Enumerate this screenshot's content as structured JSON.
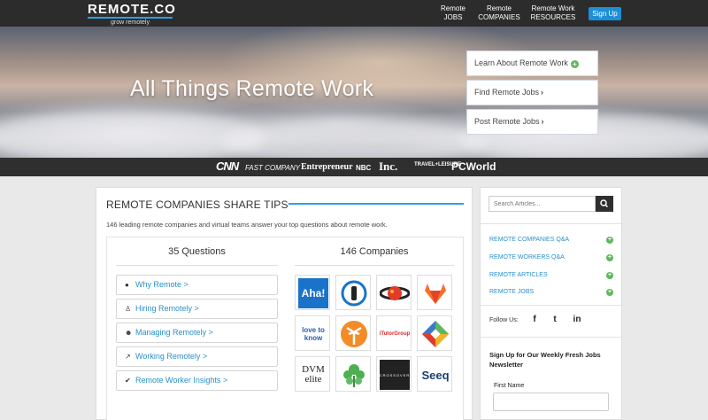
{
  "brand": {
    "name": "REMOTE.CO",
    "tagline": "grow remotely"
  },
  "nav": {
    "jobs": {
      "line1": "Remote",
      "line2": "JOBS"
    },
    "companies": {
      "line1": "Remote",
      "line2": "COMPANIES"
    },
    "resources": {
      "line1": "Remote Work",
      "line2": "RESOURCES"
    },
    "signup": "Sign Up"
  },
  "hero": {
    "title": "All Things Remote Work",
    "buttons": [
      {
        "label": "Learn About Remote Work",
        "icon": "plus-circle-icon"
      },
      {
        "label": "Find Remote Jobs",
        "icon": "chevron-right-icon"
      },
      {
        "label": "Post Remote Jobs",
        "icon": "chevron-right-icon"
      }
    ]
  },
  "press": [
    "CNN",
    "FAST COMPANY",
    "Entrepreneur",
    "NBC",
    "Inc.",
    "TRAVEL+LEISURE",
    "PCWorld"
  ],
  "main": {
    "title": "REMOTE COMPANIES SHARE TIPS",
    "description": "146 leading remote companies and virtual teams answer your top questions about remote work.",
    "questions_heading": "35 Questions",
    "companies_heading": "146 Companies",
    "questions": [
      {
        "label": "Why Remote >",
        "icon": "info-icon"
      },
      {
        "label": "Hiring Remotely >",
        "icon": "person-icon"
      },
      {
        "label": "Managing Remotely >",
        "icon": "group-icon"
      },
      {
        "label": "Working Remotely >",
        "icon": "chart-icon"
      },
      {
        "label": "Remote Worker Insights >",
        "icon": "thumbs-up-icon"
      }
    ],
    "companies": [
      {
        "name": "Aha!",
        "logo": "aha-logo"
      },
      {
        "name": "1",
        "logo": "1password-logo"
      },
      {
        "name": "",
        "logo": "planet-logo"
      },
      {
        "name": "",
        "logo": "gitlab-logo"
      },
      {
        "name": "love to know",
        "logo": "lovetoknow-logo"
      },
      {
        "name": "",
        "logo": "palm-logo"
      },
      {
        "name": "iTutorGroup",
        "logo": "itutorgroup-logo"
      },
      {
        "name": "",
        "logo": "diamond-logo"
      },
      {
        "name": "DVM elite",
        "logo": "dvm-elite-logo"
      },
      {
        "name": "",
        "logo": "leaf-logo"
      },
      {
        "name": "CROSSOVER",
        "logo": "crossover-logo"
      },
      {
        "name": "Seeq",
        "logo": "seeq-logo"
      }
    ]
  },
  "sidebar": {
    "search_placeholder": "Search Articles...",
    "links": [
      "REMOTE COMPANIES Q&A",
      "REMOTE WORKERS Q&A",
      "REMOTE ARTICLES",
      "REMOTE JOBS"
    ],
    "follow_label": "Follow Us:",
    "social": [
      {
        "glyph": "f",
        "icon": "facebook-icon"
      },
      {
        "glyph": "t",
        "icon": "twitter-icon"
      },
      {
        "glyph": "in",
        "icon": "linkedin-icon"
      }
    ],
    "newsletter_title": "Sign Up for Our Weekly Fresh Jobs Newsletter",
    "first_name_label": "First Name"
  },
  "colors": {
    "accent": "#2aa3df",
    "link": "#2a8fc8",
    "success": "#5cb85c",
    "nav_bg": "#2c2c2c"
  }
}
